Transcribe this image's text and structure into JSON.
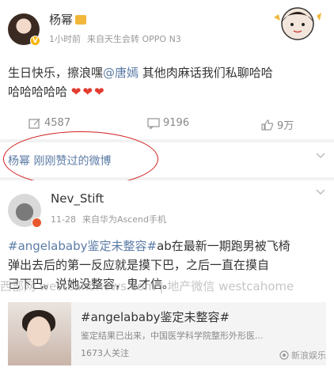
{
  "post1": {
    "username": "杨幂",
    "time": "1小时前",
    "source": "来自天生会转 OPPO N3",
    "text_before": "生日快乐，擦浪嘿",
    "mention": "@唐嫣",
    "text_after": " 其他肉麻话我们私聊哈哈",
    "text_line2": "哈哈哈哈哈",
    "hearts": [
      "❤",
      "❤",
      "❤"
    ]
  },
  "actions": {
    "repost_count": "4587",
    "comment_count": "9196",
    "like_count": "9万"
  },
  "liked_bar": {
    "text": "杨幂 刚刚赞过的微博"
  },
  "post2": {
    "username": "Nev_Stift",
    "date": "11-28",
    "source": "来自华为Ascend手机",
    "hashtag": "#angelababy鉴定未整容#",
    "text_part1": "ab在最新一期跑男被飞椅",
    "text_line2": "弹出去后的第一反应就是摸下巴，之后一直在摸自",
    "text_line3": "己下巴。说她没整容，鬼才信。",
    "watermark": "西部网 westcahonews.com | 地产微信 westcahome"
  },
  "card": {
    "title": "#angelababy鉴定未整容#",
    "description": "鉴定结果已出来，中国医学科学院整形外形医...",
    "count": "1673人关注"
  },
  "source_logo": {
    "text": "新浪娱乐"
  },
  "colors": {
    "link": "#5b7ba6",
    "heart": "#e33b2f",
    "highlight_oval": "#d21f1f"
  }
}
